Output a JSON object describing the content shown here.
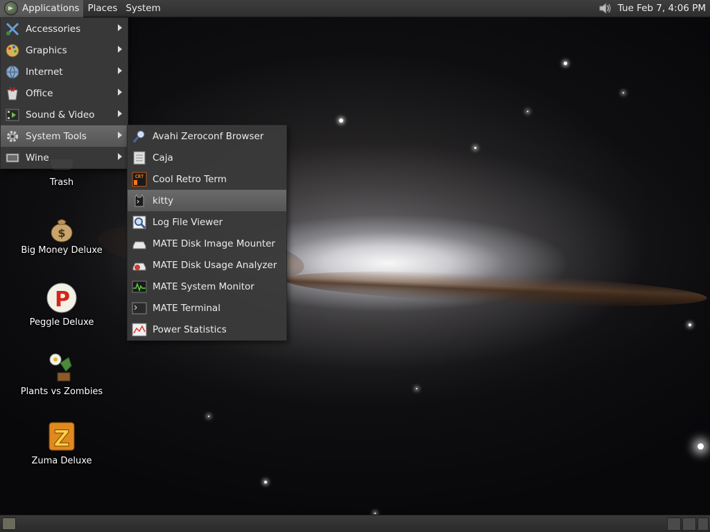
{
  "top_panel": {
    "menus": [
      "Applications",
      "Places",
      "System"
    ],
    "clock": "Tue Feb  7,  4:06 PM"
  },
  "app_menu": {
    "items": [
      {
        "label": "Accessories",
        "icon": "accessories-icon"
      },
      {
        "label": "Graphics",
        "icon": "graphics-icon"
      },
      {
        "label": "Internet",
        "icon": "internet-globe-icon"
      },
      {
        "label": "Office",
        "icon": "office-icon"
      },
      {
        "label": "Sound & Video",
        "icon": "sound-video-icon"
      },
      {
        "label": "System Tools",
        "icon": "gear-icon",
        "highlighted": true
      },
      {
        "label": "Wine",
        "icon": "wine-icon"
      }
    ]
  },
  "system_tools_menu": {
    "items": [
      {
        "label": "Avahi Zeroconf Browser",
        "icon": "avahi-icon"
      },
      {
        "label": "Caja",
        "icon": "file-manager-icon"
      },
      {
        "label": "Cool Retro Term",
        "icon": "crt-terminal-icon"
      },
      {
        "label": "kitty",
        "icon": "kitty-terminal-icon",
        "highlighted": true
      },
      {
        "label": "Log File Viewer",
        "icon": "magnifier-icon"
      },
      {
        "label": "MATE Disk Image Mounter",
        "icon": "disk-image-icon"
      },
      {
        "label": "MATE Disk Usage Analyzer",
        "icon": "disk-usage-icon"
      },
      {
        "label": "MATE System Monitor",
        "icon": "system-monitor-icon"
      },
      {
        "label": "MATE Terminal",
        "icon": "terminal-icon"
      },
      {
        "label": "Power Statistics",
        "icon": "power-stats-icon"
      }
    ]
  },
  "desktop_icons": [
    {
      "label": "Trash",
      "icon": "trash-icon"
    },
    {
      "label": "Big Money Deluxe",
      "icon": "money-bag-icon"
    },
    {
      "label": "Peggle Deluxe",
      "icon": "peggle-icon"
    },
    {
      "label": "Plants vs Zombies",
      "icon": "plants-vs-zombies-icon"
    },
    {
      "label": "Zuma Deluxe",
      "icon": "zuma-icon"
    }
  ],
  "colors": {
    "panel": "#333333",
    "menu_bg": "#3a3a3a",
    "highlight": "#5f5f5f"
  }
}
